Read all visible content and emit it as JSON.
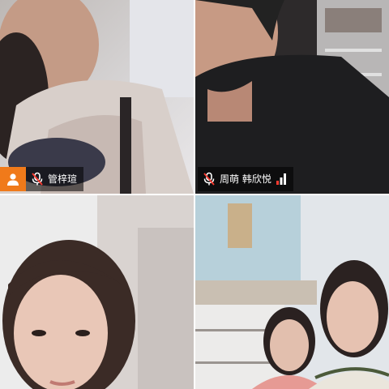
{
  "participants": [
    {
      "name": "管梓瑄",
      "is_host": true,
      "mic_muted": true
    },
    {
      "name": "周萌 韩欣悦",
      "is_host": false,
      "mic_muted": true,
      "signal_bars_active": 1
    },
    {
      "name": "",
      "is_host": false
    },
    {
      "name": "",
      "is_host": false
    }
  ],
  "colors": {
    "host_badge": "#f07a1a",
    "muted_slash": "#ff3b30",
    "signal_active": "#ff3b30",
    "signal_inactive": "#ffffff"
  },
  "icons": {
    "host": "person-icon",
    "mic": "mic-muted-icon",
    "signal": "signal-strength-icon"
  }
}
